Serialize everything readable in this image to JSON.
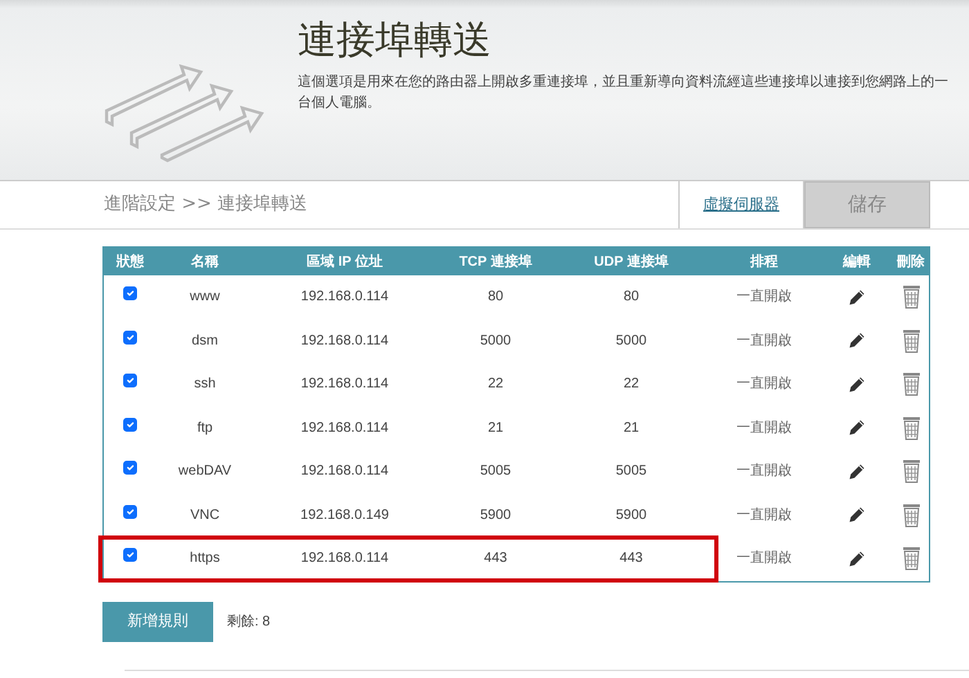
{
  "header": {
    "title": "連接埠轉送",
    "description": "這個選項是用來在您的路由器上開啟多重連接埠，並且重新導向資料流經這些連接埠以連接到您網路上的一台個人電腦。"
  },
  "breadcrumb": "進階設定 >> 連接埠轉送",
  "actions": {
    "link": "虛擬伺服器",
    "save": "儲存",
    "save_disabled": true
  },
  "table": {
    "columns": [
      "狀態",
      "名稱",
      "區域 IP 位址",
      "TCP 連接埠",
      "UDP 連接埠",
      "排程",
      "編輯",
      "刪除"
    ],
    "rows": [
      {
        "checked": true,
        "name": "www",
        "ip": "192.168.0.114",
        "tcp": "80",
        "udp": "80",
        "schedule": "一直開啟",
        "highlighted": false
      },
      {
        "checked": true,
        "name": "dsm",
        "ip": "192.168.0.114",
        "tcp": "5000",
        "udp": "5000",
        "schedule": "一直開啟",
        "highlighted": false
      },
      {
        "checked": true,
        "name": "ssh",
        "ip": "192.168.0.114",
        "tcp": "22",
        "udp": "22",
        "schedule": "一直開啟",
        "highlighted": false
      },
      {
        "checked": true,
        "name": "ftp",
        "ip": "192.168.0.114",
        "tcp": "21",
        "udp": "21",
        "schedule": "一直開啟",
        "highlighted": false
      },
      {
        "checked": true,
        "name": "webDAV",
        "ip": "192.168.0.114",
        "tcp": "5005",
        "udp": "5005",
        "schedule": "一直開啟",
        "highlighted": false
      },
      {
        "checked": true,
        "name": "VNC",
        "ip": "192.168.0.149",
        "tcp": "5900",
        "udp": "5900",
        "schedule": "一直開啟",
        "highlighted": false
      },
      {
        "checked": true,
        "name": "https",
        "ip": "192.168.0.114",
        "tcp": "443",
        "udp": "443",
        "schedule": "一直開啟",
        "highlighted": true
      }
    ]
  },
  "add_button": "新增規則",
  "remaining": "剩餘: 8"
}
